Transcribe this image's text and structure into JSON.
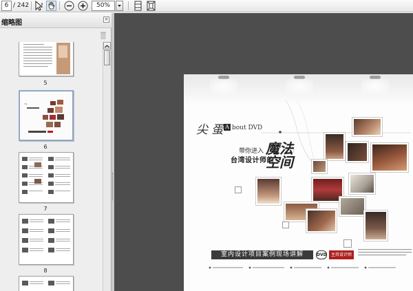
{
  "toolbar": {
    "page_current": "6",
    "page_count": "/ 242",
    "zoom": "50%",
    "icons": [
      "select-text-icon",
      "hand-tool-icon",
      "zoom-out-icon",
      "zoom-in-icon",
      "single-page-icon",
      "fit-page-icon"
    ]
  },
  "panel": {
    "title": "缩略图",
    "close_glyph": "×",
    "thumbnails": [
      {
        "number": "5",
        "selected": false
      },
      {
        "number": "6",
        "selected": true
      },
      {
        "number": "7",
        "selected": false
      },
      {
        "number": "8",
        "selected": false
      },
      {
        "number": "",
        "selected": false
      }
    ]
  },
  "page": {
    "brand_script": "尖 蛋",
    "about_letter": "A",
    "about_text": "bout DVD",
    "intro_line1": "带你进入",
    "intro_line2": "台湾设计师的",
    "magic_text": "魔法空间",
    "banner": "室内设计项目案例现场讲解",
    "dvd_logo": "DVD",
    "red_badge": "主持设计师"
  }
}
